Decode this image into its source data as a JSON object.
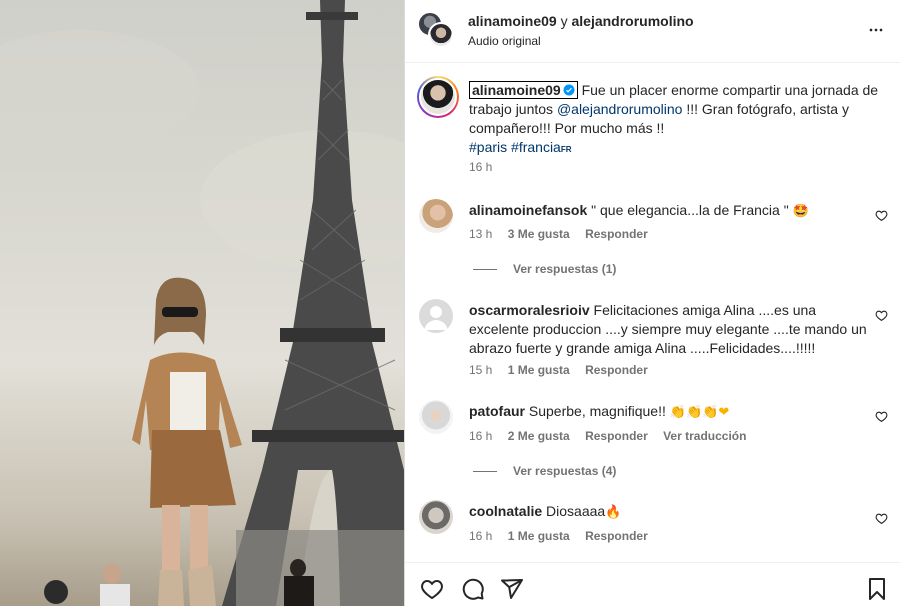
{
  "header": {
    "user1": "alinamoine09",
    "separator": "y",
    "user2": "alejandrorumolino",
    "audio": "Audio original"
  },
  "caption": {
    "username": "alinamoine09",
    "text_part1": "Fue un placer enorme compartir una jornada de trabajo juntos",
    "mention": "@alejandrorumolino",
    "text_part2": "!!! Gran fotógrafo, artista y compañero!!! Por mucho más !!",
    "hashtag1": "#paris",
    "hashtag2": "#francia",
    "flag": "FR",
    "time": "16 h"
  },
  "comments": [
    {
      "username": "alinamoinefansok",
      "text": "\" que elegancia...la de Francia \"",
      "emoji": "🤩",
      "time": "13 h",
      "likes": "3 Me gusta",
      "reply": "Responder",
      "replies": "Ver respuestas (1)"
    },
    {
      "username": "oscarmoralesrioiv",
      "text": "Felicitaciones amiga Alina ....es una excelente produccion ....y siempre muy elegante ....te mando un abrazo fuerte y grande amiga Alina .....Felicidades....!!!!!",
      "time": "15 h",
      "likes": "1 Me gusta",
      "reply": "Responder"
    },
    {
      "username": "patofaur",
      "text": "Superbe, magnifique!!",
      "emoji": "👏👏👏❤",
      "time": "16 h",
      "likes": "2 Me gusta",
      "reply": "Responder",
      "translate": "Ver traducción",
      "replies": "Ver respuestas (4)"
    },
    {
      "username": "coolnatalie",
      "text": "Diosaaaa",
      "emoji": "🔥",
      "time": "16 h",
      "likes": "1 Me gusta",
      "reply": "Responder"
    }
  ],
  "icons": {
    "like": "heart-icon",
    "comment": "comment-icon",
    "share": "share-icon",
    "save": "bookmark-icon",
    "more": "more-icon",
    "verified": "verified-badge-icon"
  },
  "colors": {
    "link": "#00376b",
    "secondary": "#737373",
    "verified": "#0095f6"
  }
}
